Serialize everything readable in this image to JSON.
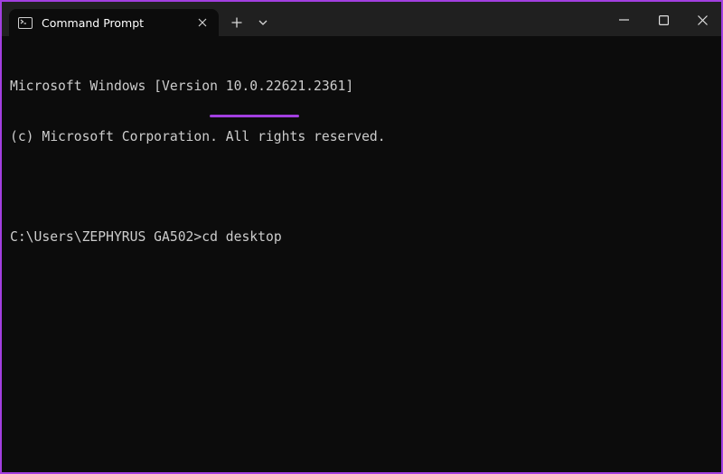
{
  "window": {
    "tab_title": "Command Prompt",
    "tab_icon": "terminal-icon",
    "new_tab_icon": "plus-icon",
    "dropdown_icon": "chevron-down-icon",
    "minimize_icon": "minimize-icon",
    "maximize_icon": "maximize-icon",
    "close_icon": "close-icon",
    "accent_color": "#a23fe0"
  },
  "console": {
    "lines": [
      "Microsoft Windows [Version 10.0.22621.2361]",
      "(c) Microsoft Corporation. All rights reserved.",
      "",
      "C:\\Users\\ZEPHYRUS GA502>cd desktop"
    ],
    "prompt": "C:\\Users\\ZEPHYRUS GA502>",
    "command": "cd desktop"
  }
}
